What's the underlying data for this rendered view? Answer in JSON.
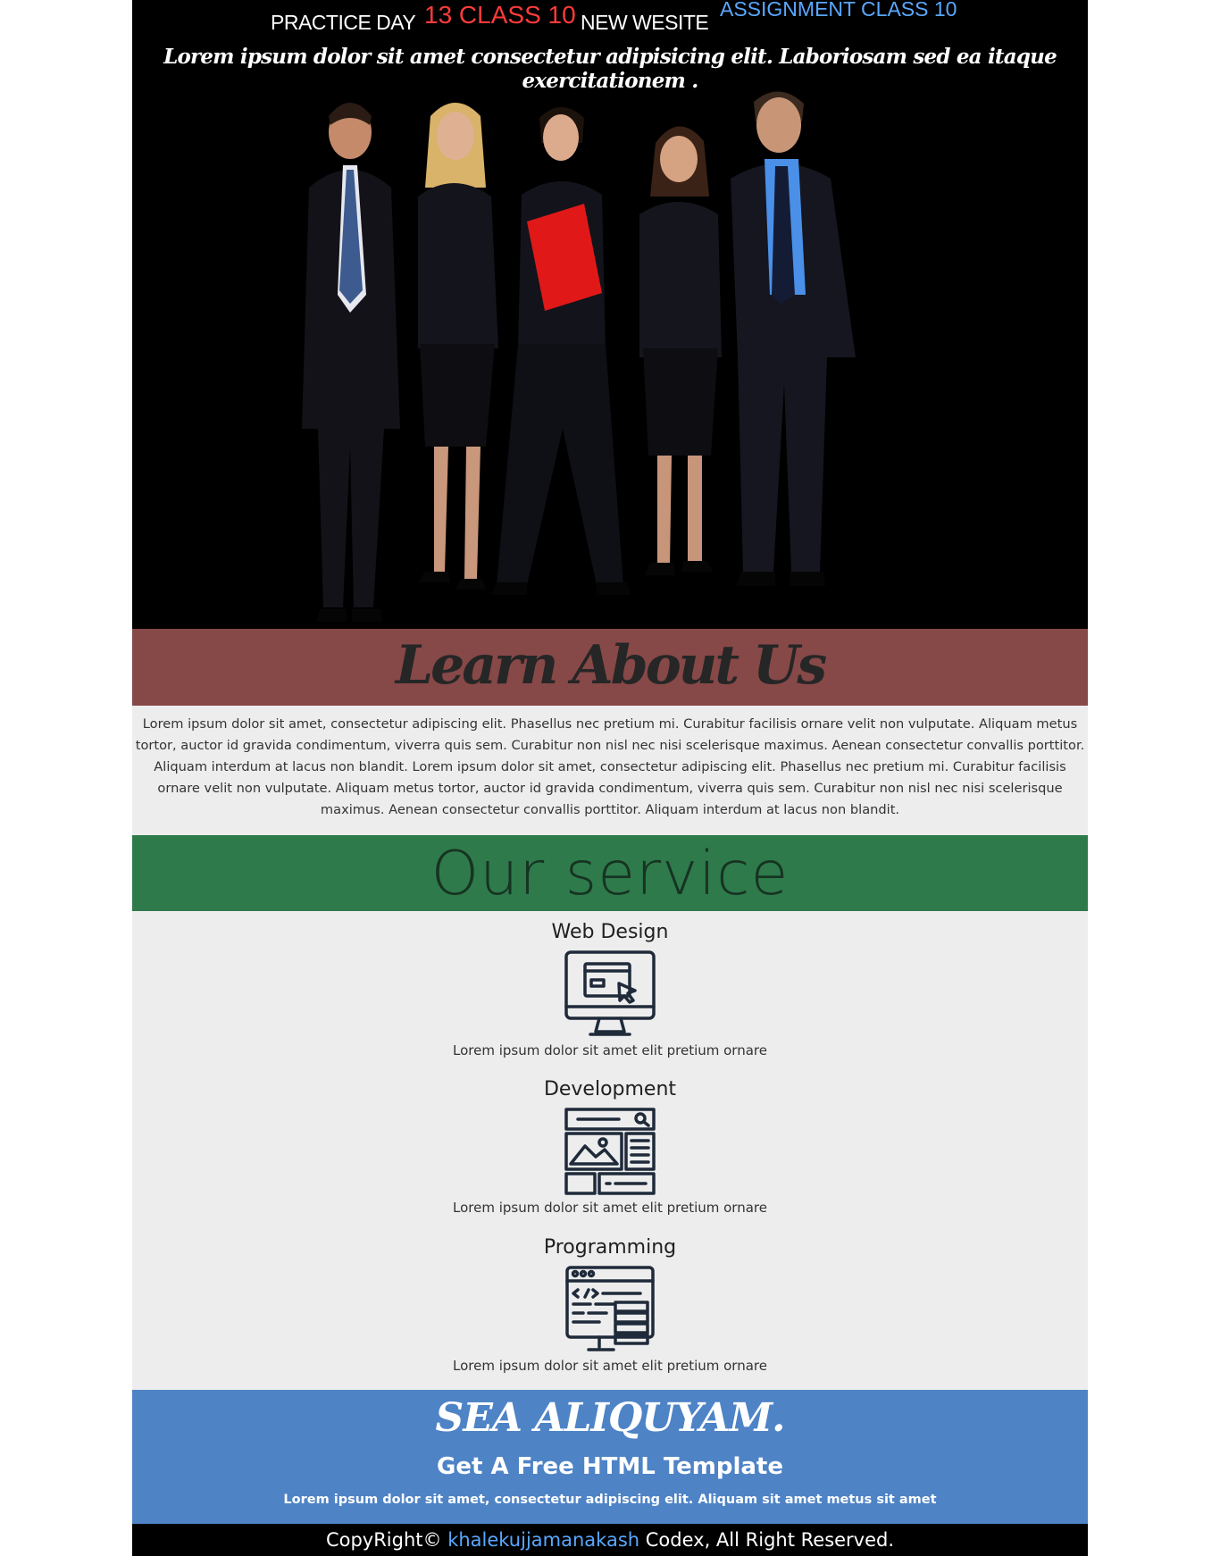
{
  "header": {
    "title_part1": "PRACTICE DAY",
    "title_part2": "13 CLASS 10",
    "title_part3": "NEW WESITE",
    "title_part4": "ASSIGNMENT CLASS 10",
    "tagline": "Lorem ipsum dolor sit amet consectetur adipisicing elit. Laboriosam sed ea itaque exercitationem ."
  },
  "about": {
    "title": "Learn About Us",
    "text": "Lorem ipsum dolor sit amet, consectetur adipiscing elit. Phasellus nec pretium mi. Curabitur facilisis ornare velit non vulputate. Aliquam metus tortor, auctor id gravida condimentum, viverra quis sem. Curabitur non nisl nec nisi scelerisque maximus. Aenean consectetur convallis porttitor. Aliquam interdum at lacus non blandit. Lorem ipsum dolor sit amet, consectetur adipiscing elit. Phasellus nec pretium mi. Curabitur facilisis ornare velit non vulputate. Aliquam metus tortor, auctor id gravida condimentum, viverra quis sem. Curabitur non nisl nec nisi scelerisque maximus. Aenean consectetur convallis porttitor. Aliquam interdum at lacus non blandit."
  },
  "service": {
    "title": "Our service",
    "items": [
      {
        "title": "Web Design",
        "icon": "monitor-cursor-icon",
        "desc": "Lorem ipsum dolor sit amet elit pretium ornare"
      },
      {
        "title": "Development",
        "icon": "web-layout-icon",
        "desc": "Lorem ipsum dolor sit amet elit pretium ornare"
      },
      {
        "title": "Programming",
        "icon": "code-server-icon",
        "desc": "Lorem ipsum dolor sit amet elit pretium ornare"
      }
    ]
  },
  "cta": {
    "title": "SEA ALIQUYAM.",
    "subtitle": "Get A Free HTML Template",
    "text": "Lorem ipsum dolor sit amet, consectetur adipiscing elit. Aliquam sit amet metus sit amet"
  },
  "footer": {
    "prefix": "CopyRight©",
    "link": "khalekujjamanakash",
    "suffix": "Codex, All Right Reserved."
  },
  "colors": {
    "hero_bg": "#000000",
    "about_bar": "#874848",
    "service_bar": "#2e7a4b",
    "cta_bg": "#4e83c6",
    "accent_red": "#ff3b3b",
    "accent_blue": "#5aa7ff"
  }
}
